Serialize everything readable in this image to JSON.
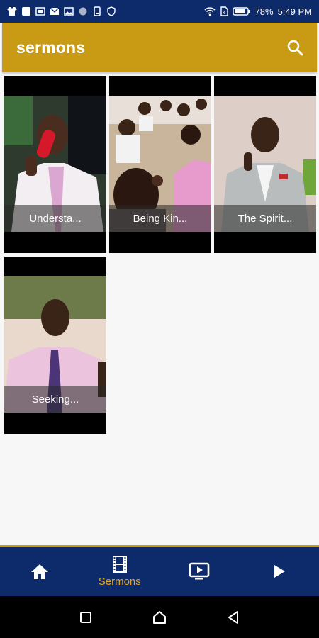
{
  "status_bar": {
    "battery": "78%",
    "time": "5:49 PM"
  },
  "app_bar": {
    "title": "sermons",
    "search_icon": "search-icon"
  },
  "sermons": [
    {
      "title": "Understa..."
    },
    {
      "title": "Being Kin..."
    },
    {
      "title": "The Spirit..."
    },
    {
      "title": "Seeking..."
    }
  ],
  "bottom_nav": {
    "items": [
      {
        "icon": "home-icon",
        "label": ""
      },
      {
        "icon": "film-icon",
        "label": "Sermons"
      },
      {
        "icon": "tv-play-icon",
        "label": ""
      },
      {
        "icon": "play-icon",
        "label": ""
      }
    ]
  },
  "colors": {
    "status_bar": "#0d2a6b",
    "app_bar": "#c99a14",
    "nav_active": "#e1a524"
  }
}
